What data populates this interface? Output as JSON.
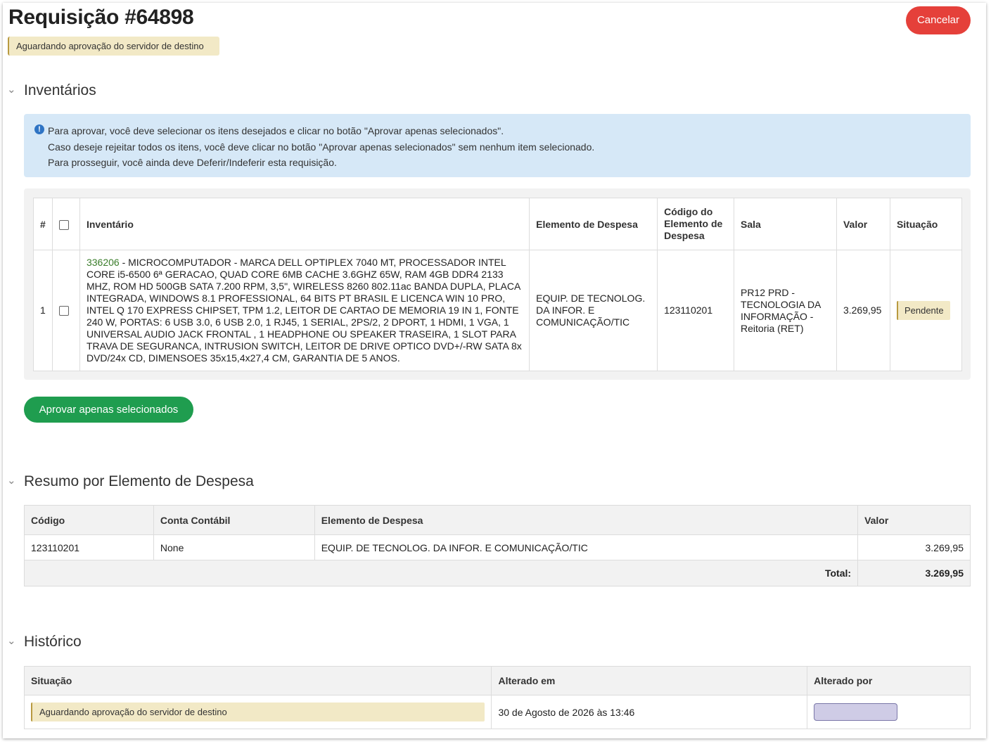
{
  "header": {
    "title": "Requisição #64898",
    "status": "Aguardando aprovação do servidor de destino",
    "cancel_label": "Cancelar"
  },
  "sections": {
    "inventarios": "Inventários",
    "resumo": "Resumo por Elemento de Despesa",
    "historico": "Histórico"
  },
  "info": {
    "lines": [
      "Para aprovar, você deve selecionar os itens desejados e clicar no botão \"Aprovar apenas selecionados\".",
      "Caso deseje rejeitar todos os itens, você deve clicar no botão \"Aprovar apenas selecionados\" sem nenhum item selecionado.",
      "Para prosseguir, você ainda deve Deferir/Indeferir esta requisição."
    ]
  },
  "inventory_table": {
    "headers": [
      "#",
      "Inventário",
      "Elemento de Despesa",
      "Código do Elemento de Despesa",
      "Sala",
      "Valor",
      "Situação"
    ],
    "rows": [
      {
        "index": "1",
        "code": "336206",
        "description": " - MICROCOMPUTADOR - MARCA DELL OPTIPLEX 7040 MT, PROCESSADOR INTEL CORE i5-6500 6ª GERACAO, QUAD CORE 6MB CACHE 3.6GHZ 65W, RAM 4GB DDR4 2133 MHZ, ROM HD 500GB SATA 7.200 RPM, 3,5\", WIRELESS 8260 802.11ac BANDA DUPLA, PLACA INTEGRADA, WINDOWS 8.1 PROFESSIONAL, 64 BITS PT BRASIL E LICENCA WIN 10 PRO, INTEL Q 170 EXPRESS CHIPSET, TPM 1.2, LEITOR DE CARTAO DE MEMORIA 19 IN 1, FONTE 240 W, PORTAS: 6 USB 3.0, 6 USB 2.0, 1 RJ45, 1 SERIAL, 2PS/2, 2 DPORT, 1 HDMI, 1 VGA, 1 UNIVERSAL AUDIO JACK FRONTAL , 1 HEADPHONE OU SPEAKER TRASEIRA, 1 SLOT PARA TRAVA DE SEGURANCA, INTRUSION SWITCH, LEITOR DE DRIVE OPTICO DVD+/-RW SATA 8x DVD/24x CD, DIMENSOES 35x15,4x27,4 CM, GARANTIA DE 5 ANOS.",
        "elemento": "EQUIP. DE TECNOLOG. DA INFOR. E COMUNICAÇÃO/TIC",
        "codigo_elemento": "123110201",
        "sala": "PR12 PRD - TECNOLOGIA DA INFORMAÇÃO - Reitoria (RET)",
        "valor": "3.269,95",
        "situacao": "Pendente"
      }
    ]
  },
  "approve_label": "Aprovar apenas selecionados",
  "resumo_table": {
    "headers": [
      "Código",
      "Conta Contábil",
      "Elemento de Despesa",
      "Valor"
    ],
    "rows": [
      {
        "codigo": "123110201",
        "conta": "None",
        "elemento": "EQUIP. DE TECNOLOG. DA INFOR. E COMUNICAÇÃO/TIC",
        "valor": "3.269,95"
      }
    ],
    "total_label": "Total:",
    "total_value": "3.269,95"
  },
  "historico_table": {
    "headers": [
      "Situação",
      "Alterado em",
      "Alterado por"
    ],
    "rows": [
      {
        "situacao": "Aguardando aprovação do servidor de destino",
        "alterado_em": "30 de Agosto de 2026 às 13:46"
      }
    ]
  },
  "colors": {
    "danger": "#e5403a",
    "success": "#1f9d4f",
    "info_bg": "#d6e8f7",
    "warning_badge": "#f2e9c6",
    "link_green": "#3a7d2a"
  }
}
